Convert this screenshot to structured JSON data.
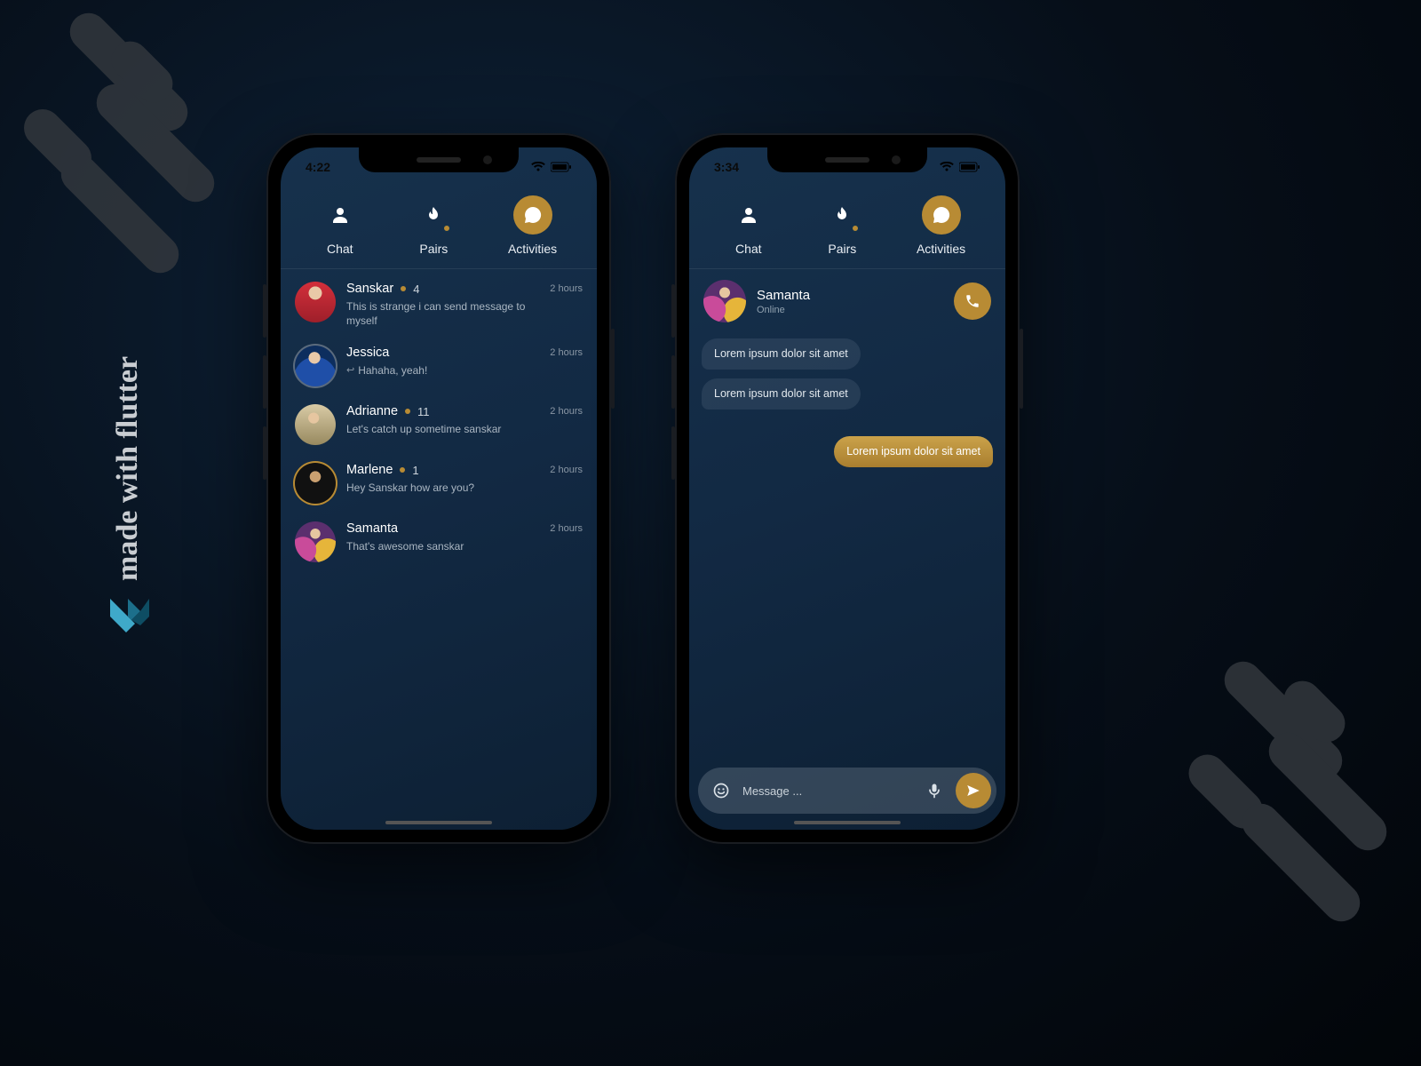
{
  "side_label": "made with flutter",
  "tabs": {
    "chat": "Chat",
    "pairs": "Pairs",
    "activities": "Activities"
  },
  "phoneA": {
    "time": "4:22",
    "items": [
      {
        "name": "Sanskar",
        "unread": "4",
        "timestamp": "2 hours",
        "preview": "This is strange i can send message to myself",
        "reply": false
      },
      {
        "name": "Jessica",
        "unread": "",
        "timestamp": "2 hours",
        "preview": "Hahaha, yeah!",
        "reply": true
      },
      {
        "name": "Adrianne",
        "unread": "11",
        "timestamp": "2 hours",
        "preview": "Let's catch up sometime sanskar",
        "reply": false
      },
      {
        "name": "Marlene",
        "unread": "1",
        "timestamp": "2 hours",
        "preview": "Hey Sanskar how are you?",
        "reply": false
      },
      {
        "name": "Samanta",
        "unread": "",
        "timestamp": "2 hours",
        "preview": "That's awesome sanskar",
        "reply": false
      }
    ]
  },
  "phoneB": {
    "time": "3:34",
    "contact": {
      "name": "Samanta",
      "status": "Online"
    },
    "messages": [
      {
        "dir": "in",
        "text": "Lorem ipsum dolor sit amet"
      },
      {
        "dir": "in",
        "text": "Lorem ipsum dolor sit amet"
      },
      {
        "dir": "out",
        "text": "Lorem ipsum dolor sit amet"
      }
    ],
    "composer_placeholder": "Message ..."
  }
}
